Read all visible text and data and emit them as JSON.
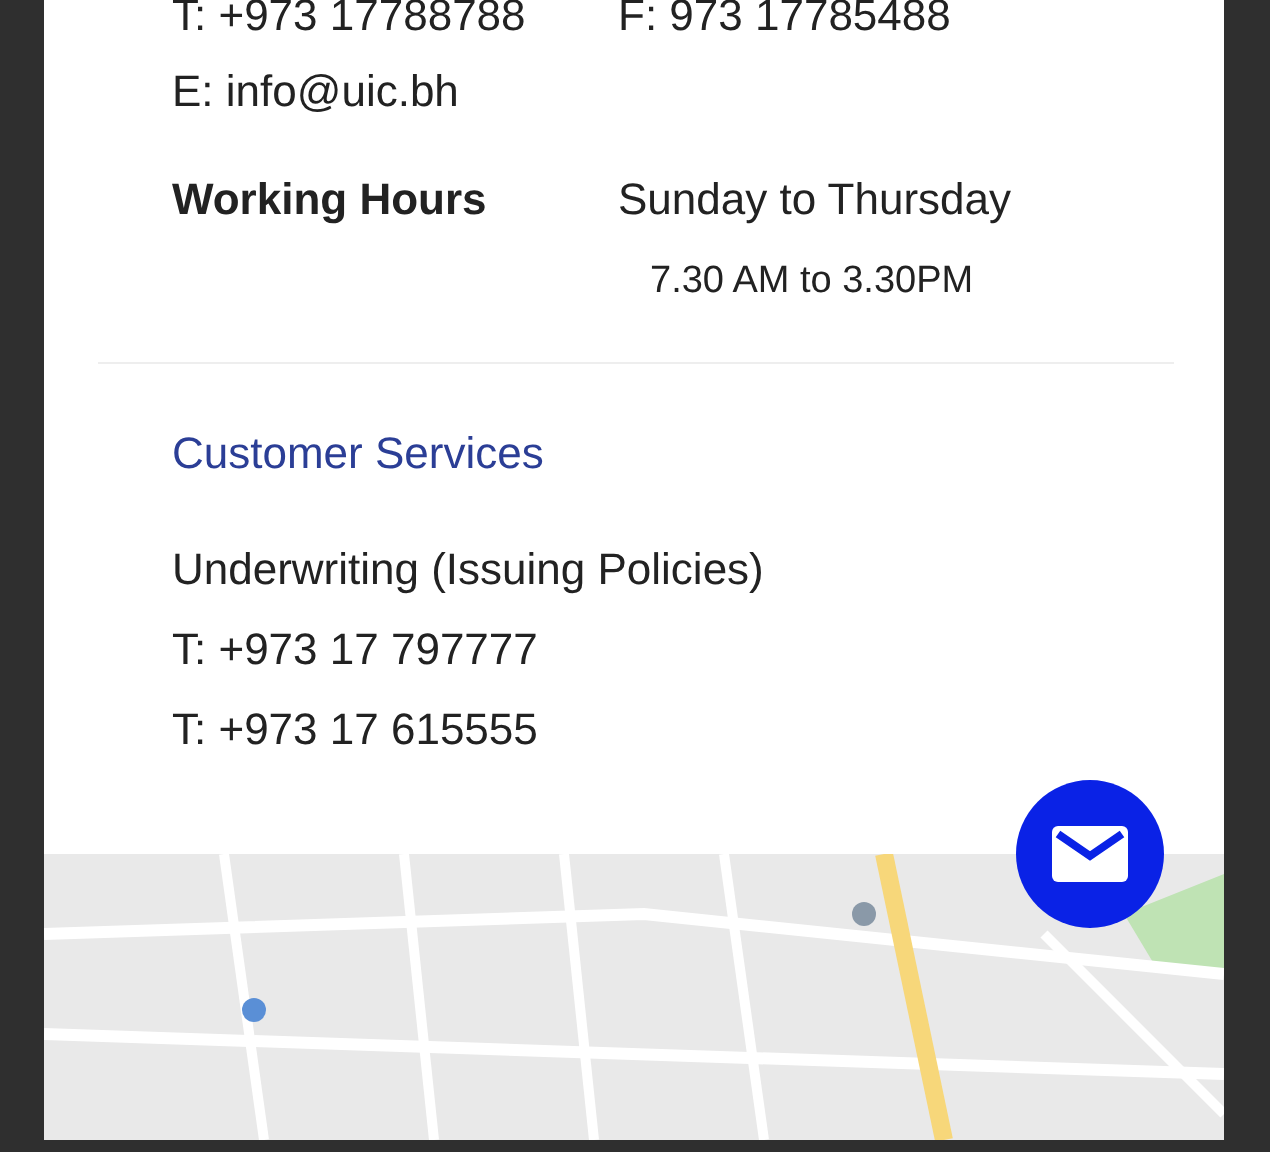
{
  "contact": {
    "phone": "T: +973 17788788",
    "fax": "F: 973 17785488",
    "email": "E: info@uic.bh"
  },
  "working_hours": {
    "label": "Working Hours",
    "days": "Sunday to Thursday",
    "time": "7.30 AM to 3.30PM"
  },
  "customer_services": {
    "title": "Customer Services",
    "lines": [
      "Underwriting (Issuing Policies)",
      "T: +973 17 797777",
      "T: +973 17 615555"
    ]
  },
  "fab": {
    "kind": "mail"
  }
}
